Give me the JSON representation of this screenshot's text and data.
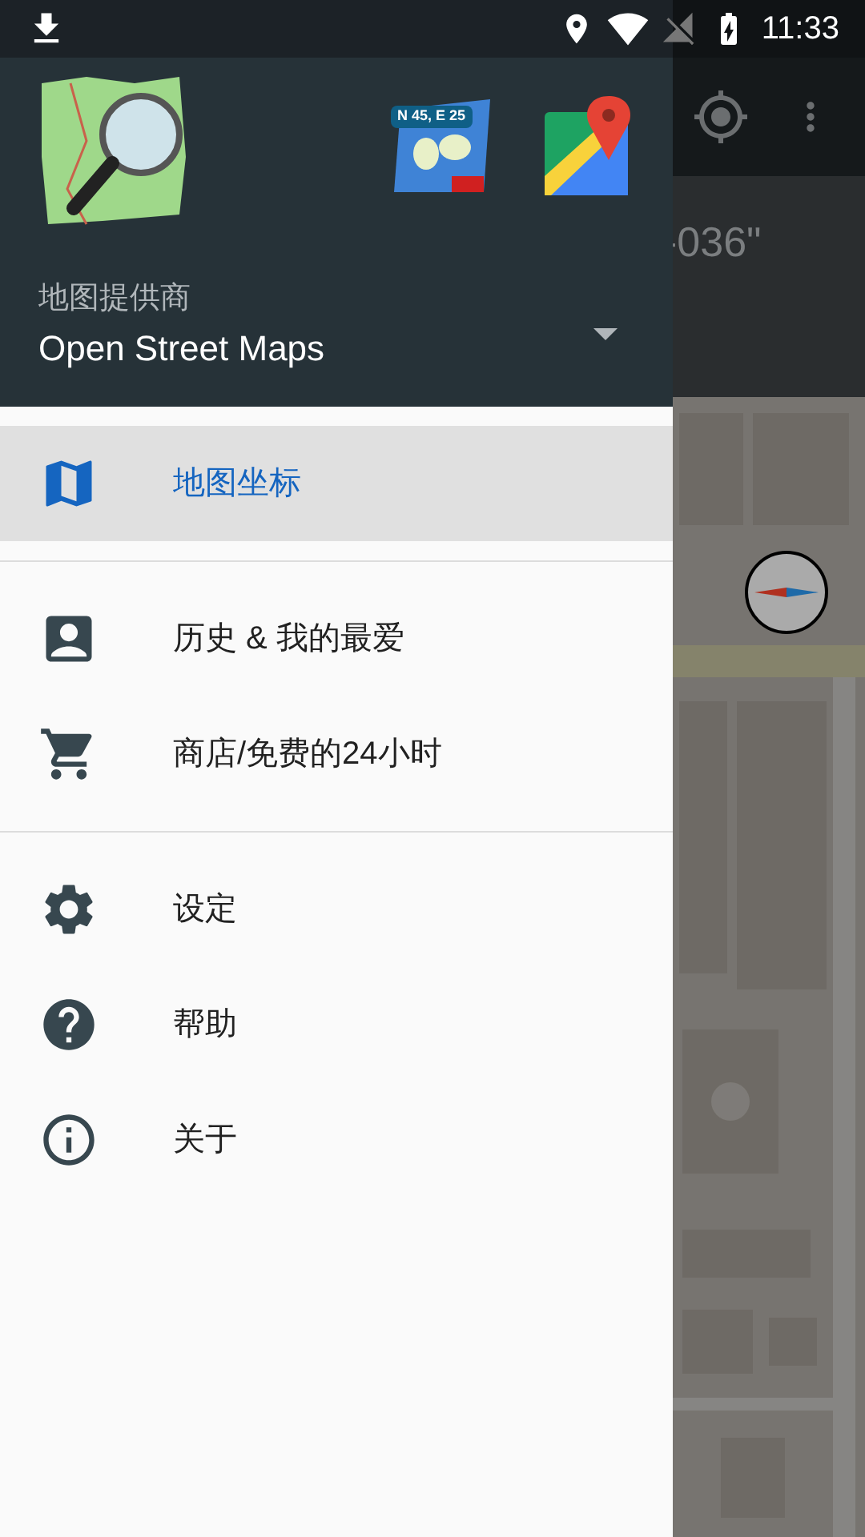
{
  "status_bar": {
    "time": "11:33"
  },
  "drawer": {
    "header": {
      "badge": "N 45, E 25",
      "provider_label": "地图提供商",
      "provider_value": "Open Street Maps"
    },
    "sections": [
      {
        "items": [
          {
            "label": "地图坐标",
            "kind": "map",
            "selected": true
          }
        ]
      },
      {
        "items": [
          {
            "label": "历史 & 我的最爱",
            "kind": "contact",
            "selected": false
          },
          {
            "label": "商店/免费的24小时",
            "kind": "cart",
            "selected": false
          }
        ]
      },
      {
        "items": [
          {
            "label": "设定",
            "kind": "gear",
            "selected": false
          },
          {
            "label": "帮助",
            "kind": "help",
            "selected": false
          },
          {
            "label": "关于",
            "kind": "info",
            "selected": false
          }
        ]
      }
    ]
  },
  "background": {
    "coordinate_fragment": "-036\""
  }
}
